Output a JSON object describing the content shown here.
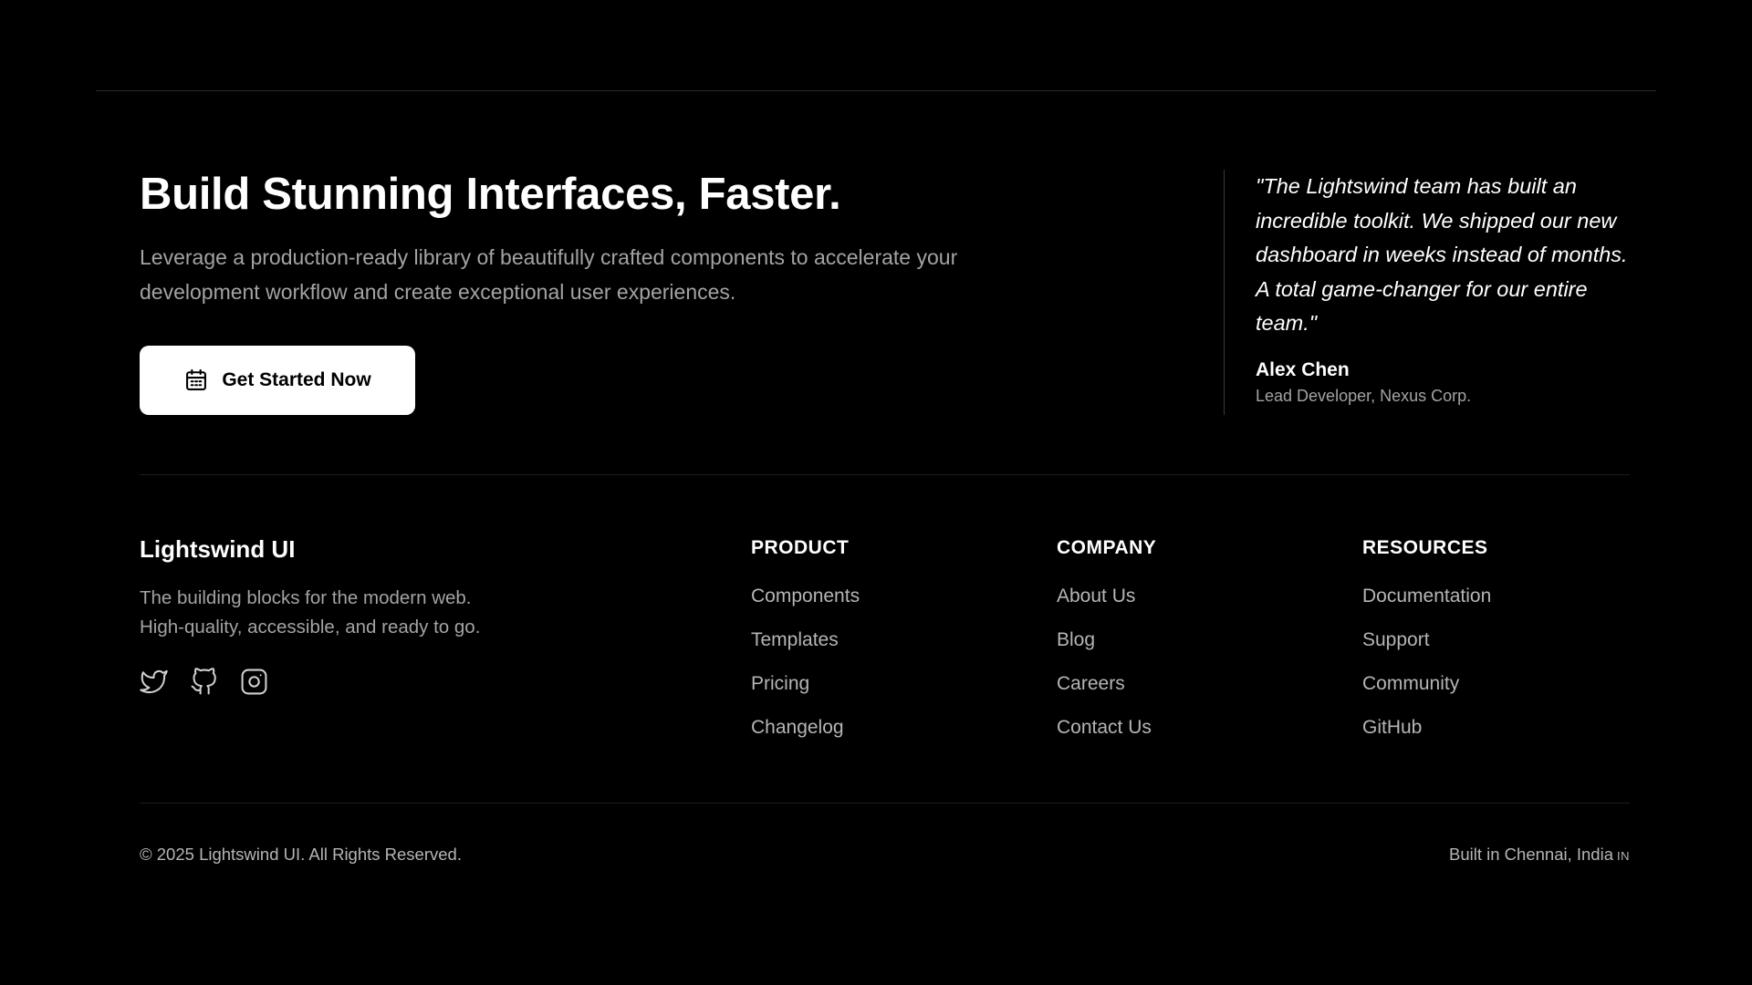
{
  "cta": {
    "headline": "Build Stunning Interfaces, Faster.",
    "subtext": "Leverage a production-ready library of beautifully crafted components to accelerate your development workflow and create exceptional user experiences.",
    "button_label": "Get Started Now",
    "button_icon": "calendar-icon"
  },
  "testimonial": {
    "quote": "\"The Lightswind team has built an incredible toolkit. We shipped our new dashboard in weeks instead of months. A total game-changer for our entire team.\"",
    "author_name": "Alex Chen",
    "author_title": "Lead Developer, Nexus Corp."
  },
  "brand": {
    "name": "Lightswind UI",
    "tagline_line1": "The building blocks for the modern web.",
    "tagline_line2": "High-quality, accessible, and ready to go.",
    "socials": [
      "twitter-icon",
      "github-icon",
      "instagram-icon"
    ]
  },
  "columns": [
    {
      "heading": "PRODUCT",
      "links": [
        "Components",
        "Templates",
        "Pricing",
        "Changelog"
      ]
    },
    {
      "heading": "COMPANY",
      "links": [
        "About Us",
        "Blog",
        "Careers",
        "Contact Us"
      ]
    },
    {
      "heading": "RESOURCES",
      "links": [
        "Documentation",
        "Support",
        "Community",
        "GitHub"
      ]
    }
  ],
  "footer": {
    "copyright": "© 2025 Lightswind UI. All Rights Reserved.",
    "built_in": "Built in Chennai, India",
    "flag_code": "IN"
  },
  "colors": {
    "background": "#000000",
    "text_primary": "#ffffff",
    "text_muted": "#a3a3a3",
    "button_bg": "#ffffff",
    "button_text": "#000000"
  }
}
